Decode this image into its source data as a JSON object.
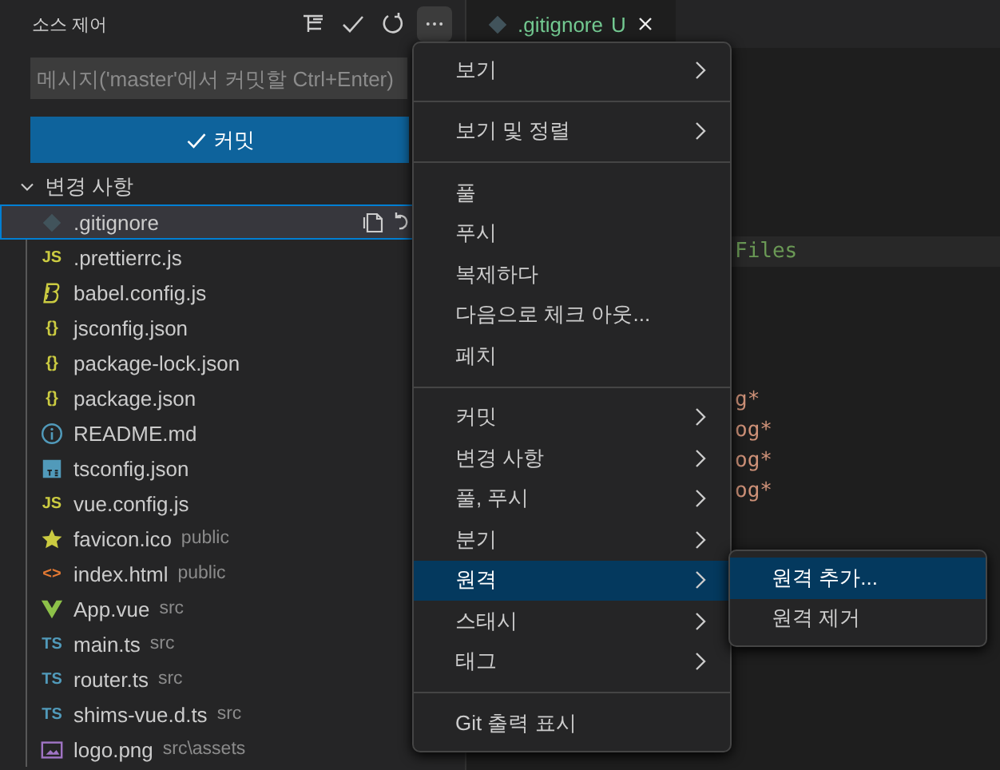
{
  "sidebar": {
    "title": "소스 제어",
    "commit_message": {
      "placeholder": "메시지('master'에서 커밋할 Ctrl+Enter)"
    },
    "commit_button": {
      "label": "커밋"
    },
    "changes": {
      "label": "변경 사항",
      "expanded": true,
      "files": [
        {
          "name": ".gitignore",
          "kind": "git",
          "selected": true
        },
        {
          "name": ".prettierrc.js",
          "kind": "js",
          "glyph": "JS",
          "selected": false
        },
        {
          "name": "babel.config.js",
          "kind": "babel",
          "selected": false
        },
        {
          "name": "jsconfig.json",
          "kind": "json",
          "glyph": "{}",
          "selected": false
        },
        {
          "name": "package-lock.json",
          "kind": "json",
          "glyph": "{}",
          "selected": false
        },
        {
          "name": "package.json",
          "kind": "json",
          "glyph": "{}",
          "selected": false
        },
        {
          "name": "README.md",
          "kind": "info",
          "selected": false
        },
        {
          "name": "tsconfig.json",
          "kind": "tsfile",
          "selected": false
        },
        {
          "name": "vue.config.js",
          "kind": "js",
          "glyph": "JS",
          "selected": false
        },
        {
          "name": "favicon.ico",
          "kind": "star",
          "folder": "public",
          "selected": false
        },
        {
          "name": "index.html",
          "kind": "html",
          "glyph": "<>",
          "folder": "public",
          "selected": false
        },
        {
          "name": "App.vue",
          "kind": "vue",
          "folder": "src",
          "selected": false
        },
        {
          "name": "main.ts",
          "kind": "ts",
          "glyph": "TS",
          "folder": "src",
          "selected": false
        },
        {
          "name": "router.ts",
          "kind": "ts",
          "glyph": "TS",
          "folder": "src",
          "selected": false
        },
        {
          "name": "shims-vue.d.ts",
          "kind": "ts",
          "glyph": "TS",
          "folder": "src",
          "selected": false
        },
        {
          "name": "logo.png",
          "kind": "image",
          "folder": "src\\assets",
          "selected": false
        }
      ]
    }
  },
  "editor": {
    "tab": {
      "label": ".gitignore",
      "status": "U"
    },
    "lines": [
      "Files",
      "g*",
      "og*",
      "og*",
      "og*"
    ]
  },
  "menu": {
    "items": [
      {
        "kind": "item",
        "label": "보기",
        "submenu": true,
        "selected": false
      },
      {
        "kind": "separator"
      },
      {
        "kind": "item",
        "label": "보기 및 정렬",
        "submenu": true,
        "selected": false
      },
      {
        "kind": "separator"
      },
      {
        "kind": "item",
        "label": "풀",
        "submenu": false,
        "selected": false
      },
      {
        "kind": "item",
        "label": "푸시",
        "submenu": false,
        "selected": false
      },
      {
        "kind": "item",
        "label": "복제하다",
        "submenu": false,
        "selected": false
      },
      {
        "kind": "item",
        "label": "다음으로 체크 아웃...",
        "submenu": false,
        "selected": false
      },
      {
        "kind": "item",
        "label": "페치",
        "submenu": false,
        "selected": false
      },
      {
        "kind": "separator"
      },
      {
        "kind": "item",
        "label": "커밋",
        "submenu": true,
        "selected": false
      },
      {
        "kind": "item",
        "label": "변경 사항",
        "submenu": true,
        "selected": false
      },
      {
        "kind": "item",
        "label": "풀, 푸시",
        "submenu": true,
        "selected": false
      },
      {
        "kind": "item",
        "label": "분기",
        "submenu": true,
        "selected": false
      },
      {
        "kind": "item",
        "label": "원격",
        "submenu": true,
        "selected": true
      },
      {
        "kind": "item",
        "label": "스태시",
        "submenu": true,
        "selected": false
      },
      {
        "kind": "item",
        "label": "태그",
        "submenu": true,
        "selected": false
      },
      {
        "kind": "separator"
      },
      {
        "kind": "item",
        "label": "Git 출력 표시",
        "submenu": false,
        "selected": false
      }
    ]
  },
  "submenu": {
    "items": [
      {
        "label": "원격 추가...",
        "selected": true
      },
      {
        "label": "원격 제거",
        "selected": false
      }
    ]
  }
}
